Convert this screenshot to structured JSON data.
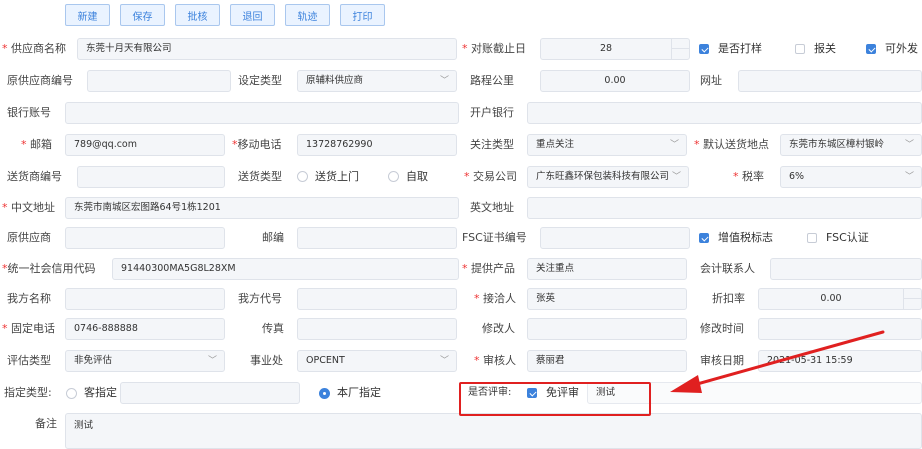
{
  "toolbar": {
    "new": "新建",
    "save": "保存",
    "approve": "批核",
    "back": "退回",
    "track": "轨迹",
    "print": "打印"
  },
  "row1": {
    "supplier_name_label": "供应商名称",
    "supplier_name": "东莞十月天有限公司",
    "cutoff_label": "对账截止日",
    "cutoff": "28",
    "sample_label": "是否打样",
    "customs_label": "报关",
    "exportable_label": "可外发"
  },
  "row2": {
    "orig_code_label": "原供应商编号",
    "orig_code": "",
    "type_label": "设定类型",
    "type": "原辅料供应商",
    "distance_label": "路程公里",
    "distance": "0.00",
    "website_label": "网址",
    "website": ""
  },
  "row3": {
    "account_label": "银行账号",
    "account": "",
    "bank_label": "开户银行",
    "bank": ""
  },
  "row4": {
    "email_label": "邮箱",
    "email": "789@qq.com",
    "mobile_label": "移动电话",
    "mobile": "13728762990",
    "focus_label": "关注类型",
    "focus": "重点关注",
    "delivery_label": "默认送货地点",
    "delivery": "东莞市东城区樟村银岭"
  },
  "row5": {
    "ship_code_label": "送货商编号",
    "ship_code": "",
    "ship_type_label": "送货类型",
    "ship_opt1": "送货上门",
    "ship_opt2": "自取",
    "trade_co_label": "交易公司",
    "trade_co": "广东旺鑫环保包装科技有限公司",
    "tax_label": "税率",
    "tax": "6%"
  },
  "row6": {
    "cn_addr_label": "中文地址",
    "cn_addr": "东莞市南城区宏图路64号1栋1201",
    "en_addr_label": "英文地址",
    "en_addr": ""
  },
  "row7": {
    "orig_supplier_label": "原供应商",
    "orig_supplier": "",
    "zip_label": "邮编",
    "zip": "",
    "fsc_no_label": "FSC证书编号",
    "fsc_no": "",
    "vat_label": "增值税标志",
    "fsc_cert_label": "FSC认证"
  },
  "row8": {
    "credit_label": "统一社会信用代码",
    "credit": "91440300MA5G8L28XM",
    "product_label": "提供产品",
    "product": "关注重点",
    "contact_label": "会计联系人",
    "contact": ""
  },
  "row9": {
    "our_name_label": "我方名称",
    "our_name": "",
    "our_code_label": "我方代号",
    "our_code": "",
    "handler_label": "接洽人",
    "handler": "张英",
    "discount_label": "折扣率",
    "discount": "0.00"
  },
  "row10": {
    "phone_label": "固定电话",
    "phone": "0746-888888",
    "fax_label": "传真",
    "fax": "",
    "modifier_label": "修改人",
    "modifier": "",
    "modtime_label": "修改时间",
    "modtime": ""
  },
  "row11": {
    "eval_label": "评估类型",
    "eval": "非免评估",
    "dept_label": "事业处",
    "dept": "OPCENT",
    "reviewer_label": "审核人",
    "reviewer": "蔡丽君",
    "review_date_label": "审核日期",
    "review_date": "2021-05-31 15:59"
  },
  "row12": {
    "assign_label": "指定类型:",
    "assign_opt1": "客指定",
    "assign_opt1_input": "",
    "assign_opt2": "本厂指定",
    "review_q_label": "是否评审:",
    "exempt_label": "免评审",
    "exempt_note": "测试"
  },
  "row13": {
    "remark_label": "备注",
    "remark": "测试"
  },
  "colors": {
    "accent": "#3c82dc",
    "required": "#e33",
    "annotation": "#e02020"
  }
}
